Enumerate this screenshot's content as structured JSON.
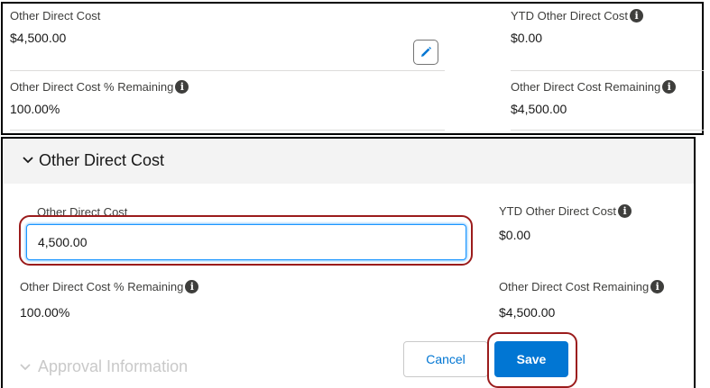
{
  "view_panel": {
    "other_direct_cost": {
      "label": "Other Direct Cost",
      "value": "$4,500.00"
    },
    "ytd_other_direct_cost": {
      "label": "YTD Other Direct Cost",
      "value": "$0.00"
    },
    "percent_remaining": {
      "label": "Other Direct Cost % Remaining",
      "value": "100.00%"
    },
    "cost_remaining": {
      "label": "Other Direct Cost Remaining",
      "value": "$4,500.00"
    },
    "edit_icon": "pencil-icon",
    "info_glyph": "i"
  },
  "edit_panel": {
    "section_title": "Other Direct Cost",
    "other_direct_cost": {
      "label": "Other Direct Cost",
      "input_value": "4,500.00"
    },
    "ytd_other_direct_cost": {
      "label": "YTD Other Direct Cost",
      "value": "$0.00"
    },
    "percent_remaining": {
      "label": "Other Direct Cost % Remaining",
      "value": "100.00%"
    },
    "cost_remaining": {
      "label": "Other Direct Cost Remaining",
      "value": "$4,500.00"
    },
    "next_section_title": "Approval Information",
    "cancel_label": "Cancel",
    "save_label": "Save"
  },
  "colors": {
    "brand": "#0176d3",
    "focus": "#1b96ff",
    "highlight_outline": "#9b1c1c"
  }
}
